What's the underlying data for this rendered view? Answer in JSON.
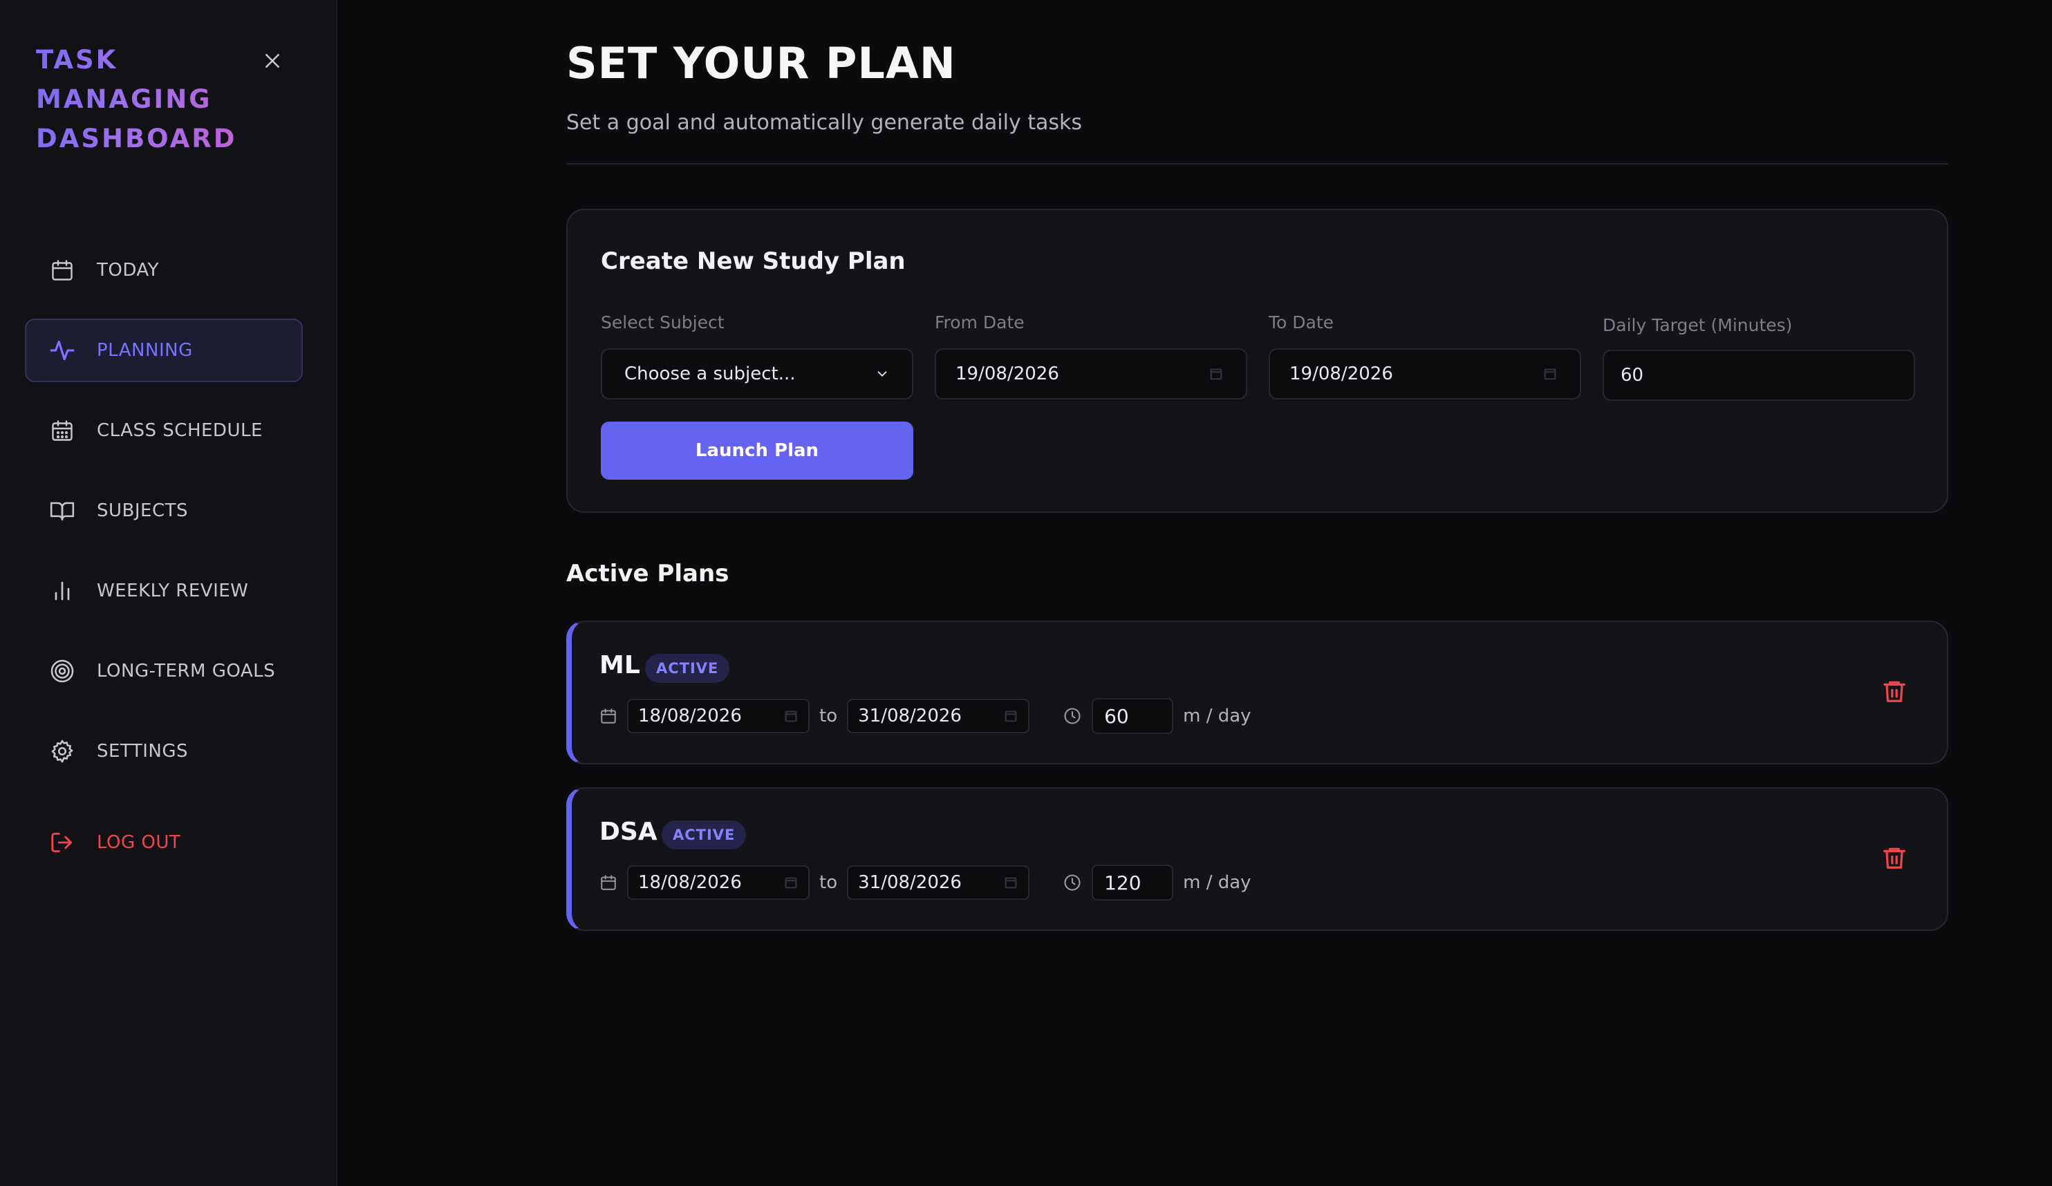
{
  "sidebar": {
    "brand_lines": [
      "TASK",
      "MANAGING",
      "DASHBOARD"
    ],
    "items": [
      {
        "label": "TODAY",
        "icon": "calendar-icon"
      },
      {
        "label": "PLANNING",
        "icon": "activity-icon",
        "active": true
      },
      {
        "label": "CLASS SCHEDULE",
        "icon": "calendar-grid-icon"
      },
      {
        "label": "SUBJECTS",
        "icon": "book-icon"
      },
      {
        "label": "WEEKLY REVIEW",
        "icon": "bar-chart-icon"
      },
      {
        "label": "LONG-TERM GOALS",
        "icon": "target-icon"
      },
      {
        "label": "SETTINGS",
        "icon": "gear-icon"
      }
    ],
    "logout_label": "LOG OUT"
  },
  "header": {
    "title": "SET YOUR PLAN",
    "subtitle": "Set a goal and automatically generate daily tasks"
  },
  "create_plan": {
    "title": "Create New Study Plan",
    "subject_label": "Select Subject",
    "subject_value": "Choose a subject...",
    "from_label": "From Date",
    "from_value": "19/08/2026",
    "to_label": "To Date",
    "to_value": "19/08/2026",
    "target_label": "Daily Target (Minutes)",
    "target_value": "60",
    "launch_label": "Launch Plan"
  },
  "active_plans": {
    "title": "Active Plans",
    "plans": [
      {
        "name": "ML",
        "status": "ACTIVE",
        "from": "18/08/2026",
        "to": "31/08/2026",
        "minutes": "60"
      },
      {
        "name": "DSA",
        "status": "ACTIVE",
        "from": "18/08/2026",
        "to": "31/08/2026",
        "minutes": "120"
      }
    ],
    "to_sep": "to",
    "unit": "m / day"
  },
  "colors": {
    "accent": "#6463f2",
    "danger": "#f0454d",
    "background": "#0b0b0d",
    "sidebar": "#121216"
  }
}
